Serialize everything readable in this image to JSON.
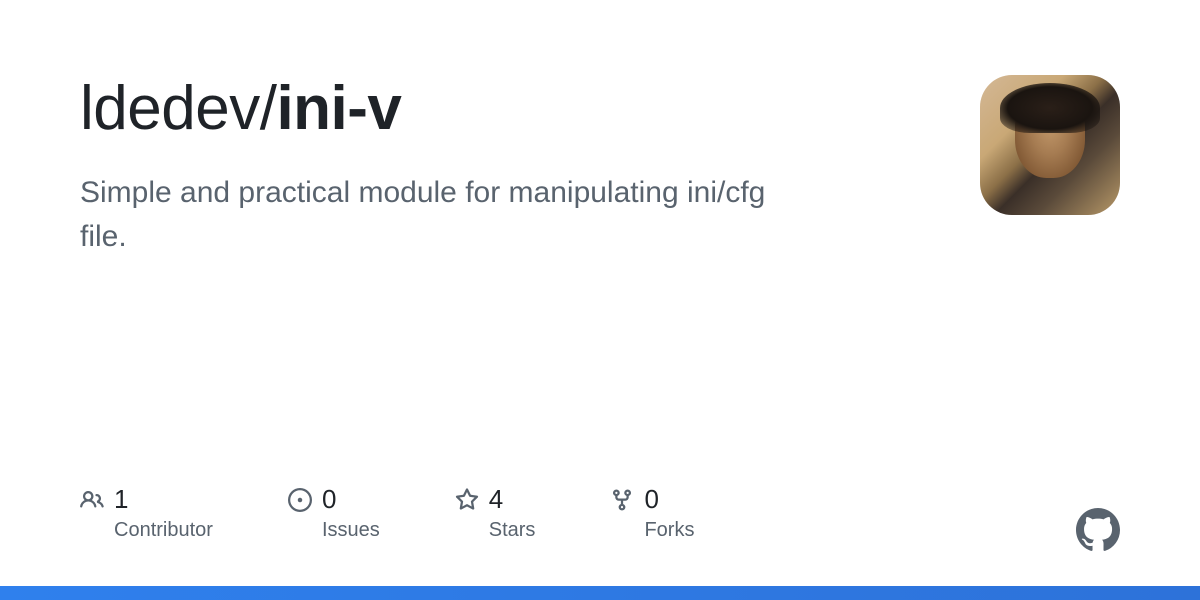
{
  "repo": {
    "owner": "ldedev",
    "name": "ini-v",
    "description": "Simple and practical module for manipulating ini/cfg file."
  },
  "stats": [
    {
      "icon": "people",
      "count": "1",
      "label": "Contributor"
    },
    {
      "icon": "issue",
      "count": "0",
      "label": "Issues"
    },
    {
      "icon": "star",
      "count": "4",
      "label": "Stars"
    },
    {
      "icon": "fork",
      "count": "0",
      "label": "Forks"
    }
  ]
}
